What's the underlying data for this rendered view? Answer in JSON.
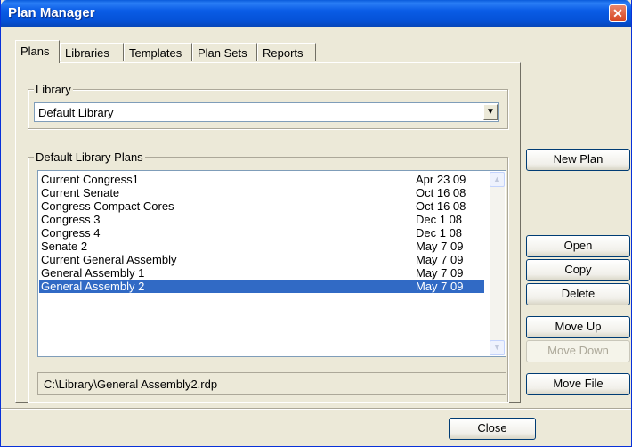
{
  "window": {
    "title": "Plan Manager",
    "close_glyph": "✕"
  },
  "tabs": [
    {
      "label": "Plans",
      "active": true
    },
    {
      "label": "Libraries",
      "active": false
    },
    {
      "label": "Templates",
      "active": false
    },
    {
      "label": "Plan Sets",
      "active": false
    },
    {
      "label": "Reports",
      "active": false
    }
  ],
  "library": {
    "group_label": "Library",
    "selected": "Default Library",
    "arrow_glyph": "▼"
  },
  "plans": {
    "group_label": "Default Library Plans",
    "rows": [
      {
        "name": "Current Congress1",
        "date": "Apr 23 09"
      },
      {
        "name": "Current Senate",
        "date": "Oct 16 08"
      },
      {
        "name": "Congress Compact Cores",
        "date": "Oct 16 08"
      },
      {
        "name": "Congress 3",
        "date": "Dec 1 08"
      },
      {
        "name": "Congress 4",
        "date": "Dec 1 08"
      },
      {
        "name": "Senate 2",
        "date": "May 7 09"
      },
      {
        "name": "Current General Assembly",
        "date": "May 7 09"
      },
      {
        "name": "General Assembly 1",
        "date": "May 7 09"
      },
      {
        "name": "General Assembly 2",
        "date": "May 7 09"
      }
    ],
    "selected_index": 8,
    "scroll_up_glyph": "▲",
    "scroll_down_glyph": "▼",
    "path": "C:\\Library\\General Assembly2.rdp"
  },
  "buttons": {
    "new_plan": "New Plan",
    "open": "Open",
    "copy": "Copy",
    "delete": "Delete",
    "move_up": "Move Up",
    "move_down": "Move Down",
    "move_file": "Move File",
    "close": "Close"
  },
  "colors": {
    "selection": "#316ac5",
    "titlebar": "#0551d6",
    "face": "#ece9d8"
  }
}
